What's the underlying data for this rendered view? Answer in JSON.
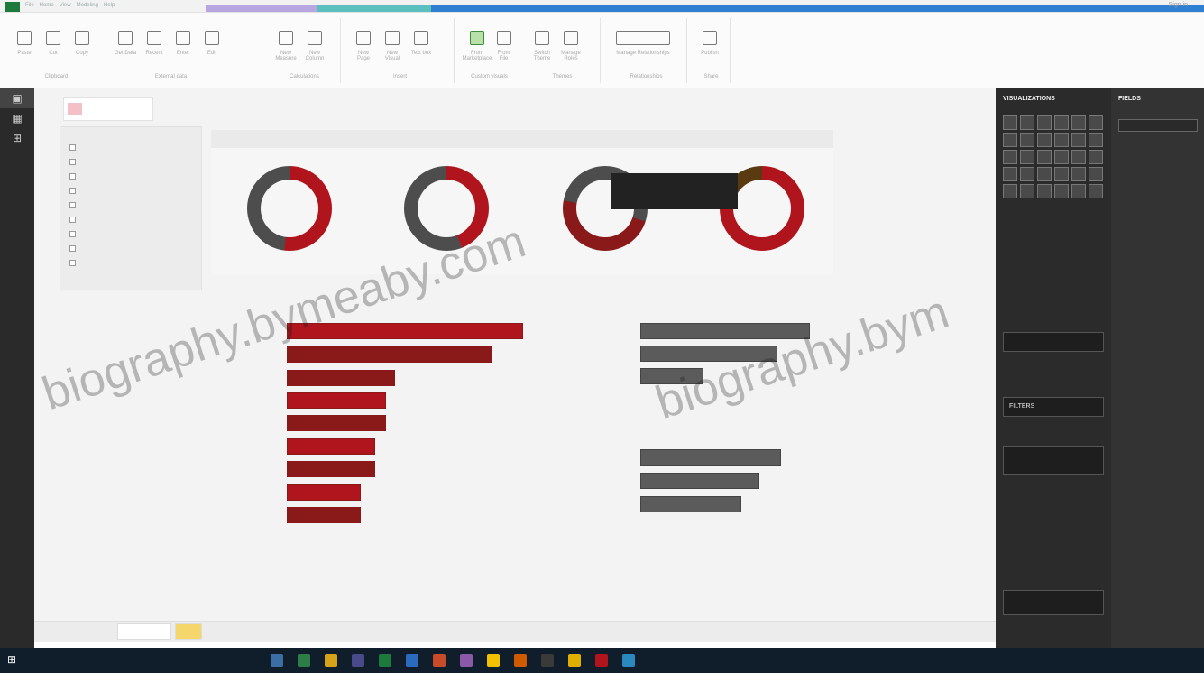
{
  "window": {
    "tabs": [
      "File",
      "Home",
      "View",
      "Modeling",
      "Help"
    ],
    "signin": "Sign in"
  },
  "ribbon": {
    "groups": [
      {
        "label": "Clipboard",
        "buttons": [
          "Paste",
          "Cut",
          "Copy"
        ]
      },
      {
        "label": "External data",
        "buttons": [
          "Get Data",
          "Recent",
          "Enter",
          "Edit"
        ]
      },
      {
        "label": "Calculations",
        "buttons": [
          "New Measure",
          "New Column"
        ]
      },
      {
        "label": "Insert",
        "buttons": [
          "New Page",
          "New Visual",
          "Text box"
        ]
      },
      {
        "label": "Custom visuals",
        "buttons": [
          "From Marketplace",
          "From File"
        ]
      },
      {
        "label": "Themes",
        "buttons": [
          "Switch Theme",
          "Manage Roles"
        ]
      },
      {
        "label": "Relationships",
        "buttons": [
          "Manage Relationships"
        ]
      },
      {
        "label": "Share",
        "buttons": [
          "Publish"
        ]
      }
    ]
  },
  "leftnav": {
    "items": [
      "report-icon",
      "data-icon",
      "model-icon"
    ]
  },
  "canvas": {
    "logo_text": "",
    "slicer_items": [
      "",
      "",
      "",
      "",
      "",
      "",
      "",
      "",
      ""
    ],
    "donut_titles": [
      "",
      "",
      "",
      ""
    ],
    "tooltip": {
      "line1": "",
      "line2": ""
    },
    "left_bar_title": "",
    "right_bar_title_top": "",
    "right_bar_title_bottom": ""
  },
  "colors": {
    "accent_red": "#b0141c",
    "dark_red": "#7a1f1f",
    "donut_gray": "#4d4d4d",
    "bar_gray": "#5b5b5b",
    "pane_dark": "#2b2b2b"
  },
  "pages": {
    "tabs": [
      "",
      ""
    ]
  },
  "viz_pane": {
    "title": "VISUALIZATIONS",
    "sections": [
      "",
      "",
      "",
      "",
      "",
      "",
      "",
      "",
      "",
      "FILTERS",
      "",
      "",
      "",
      "",
      "",
      "",
      ""
    ]
  },
  "fields_pane": {
    "title": "FIELDS",
    "items": [
      "",
      "",
      "",
      ""
    ]
  },
  "taskbar": {
    "tray": "",
    "time": ""
  },
  "watermark": {
    "text1": "biography.bymeaby.com",
    "text2": "biography.bym"
  }
}
